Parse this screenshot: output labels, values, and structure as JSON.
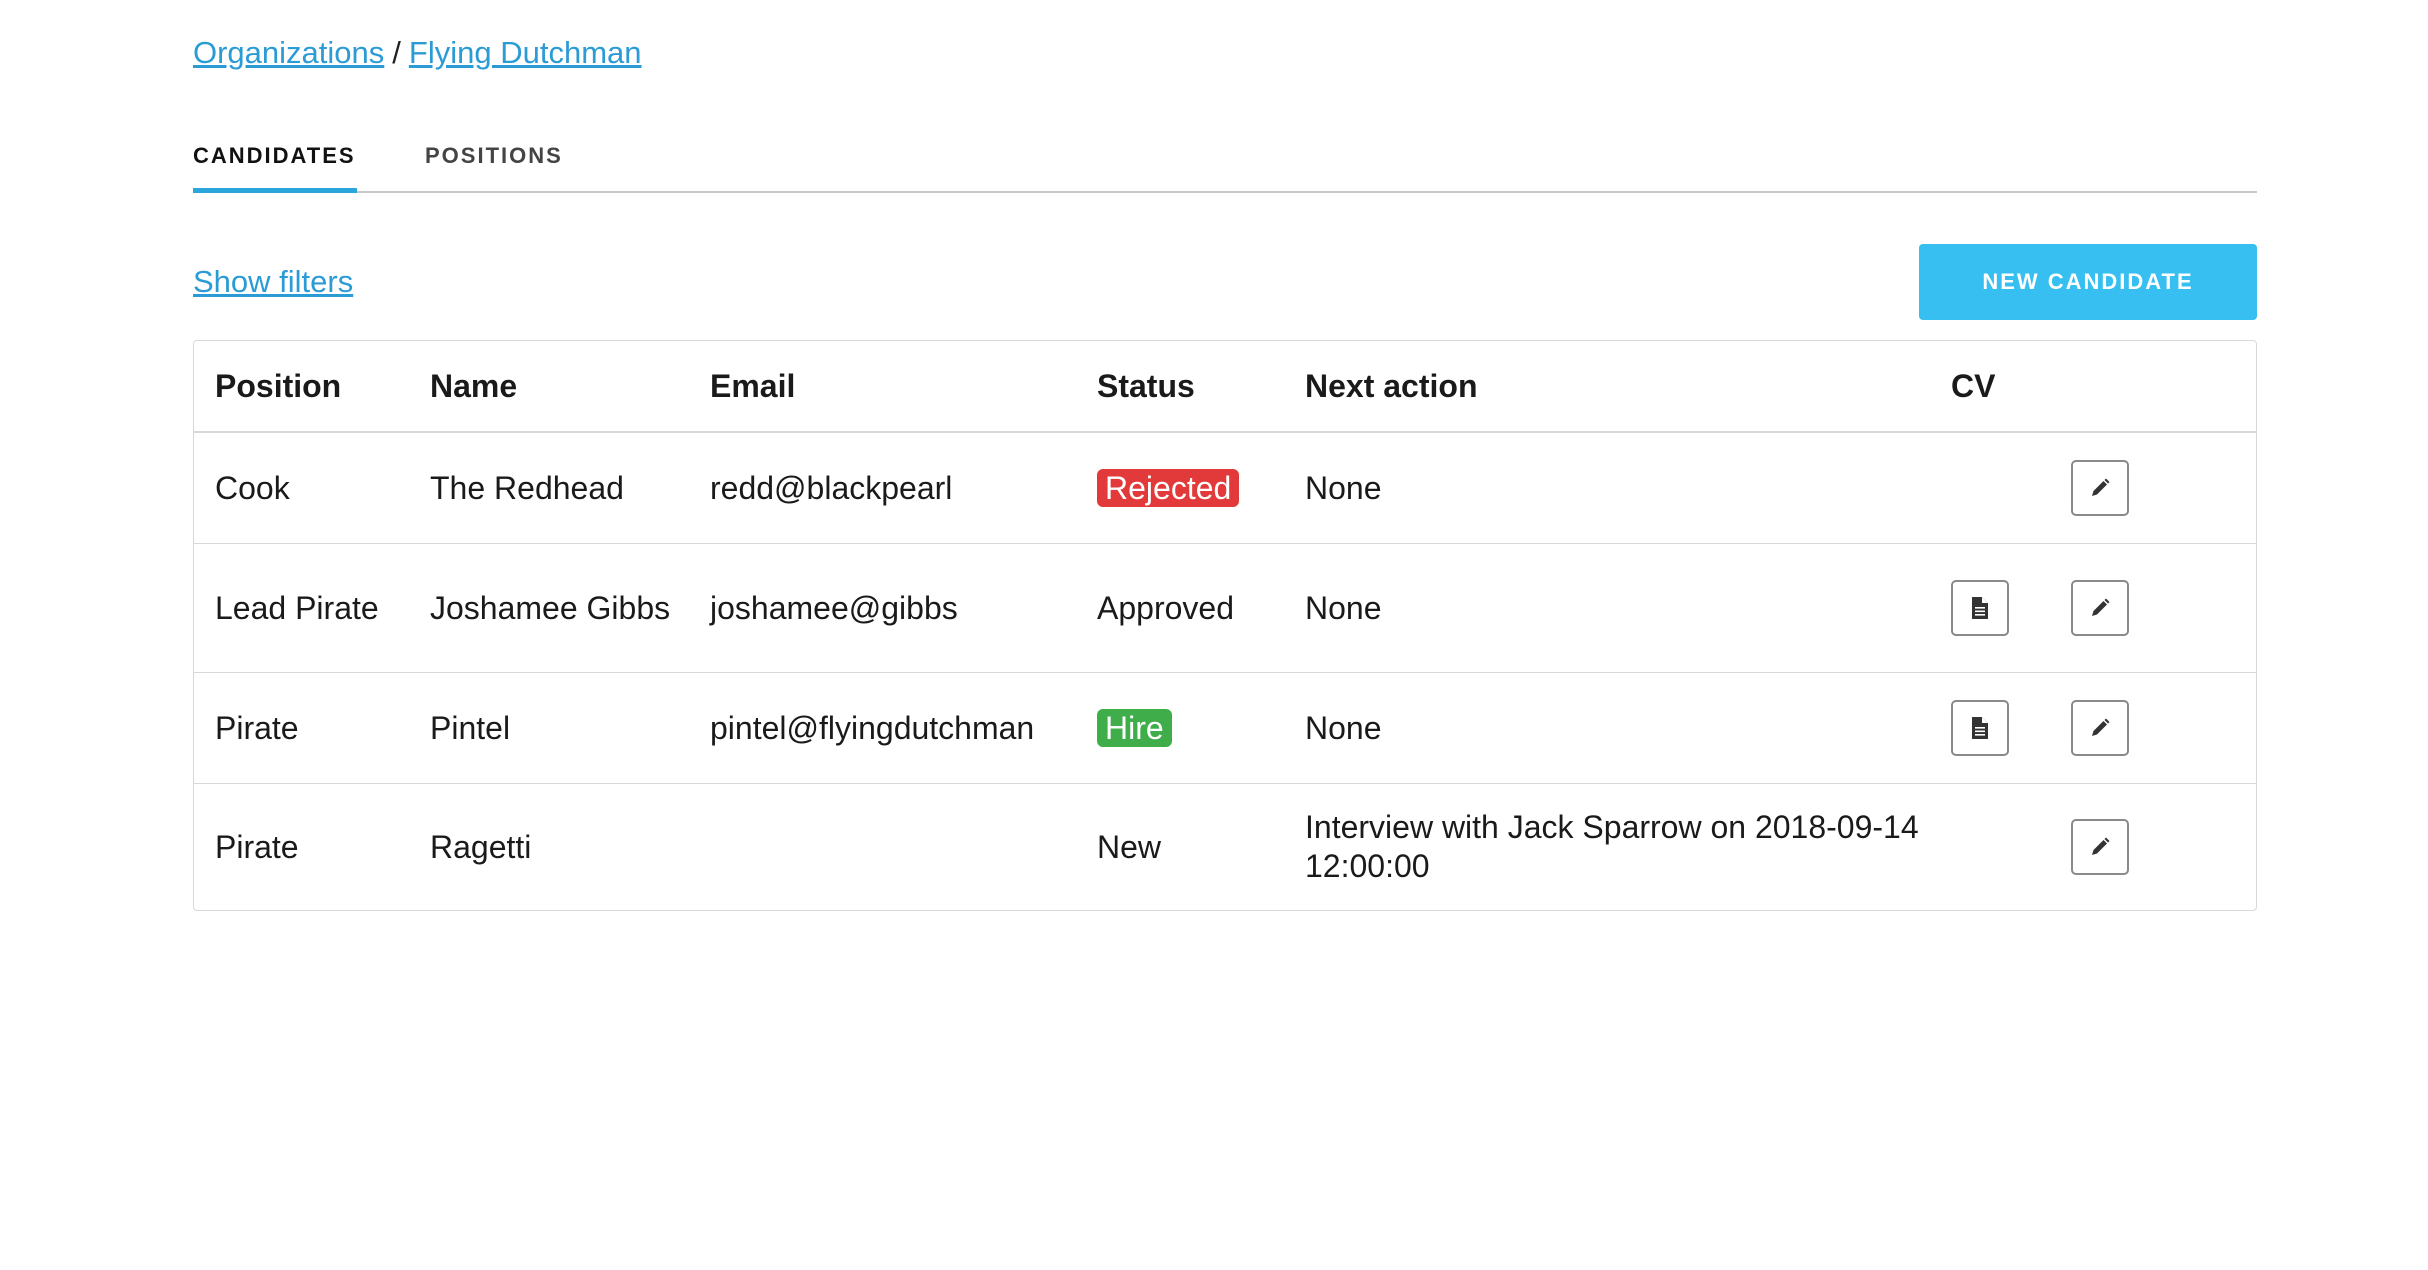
{
  "breadcrumb": {
    "organizations": "Organizations",
    "separator": "/",
    "current": "Flying Dutchman"
  },
  "tabs": [
    {
      "label": "CANDIDATES",
      "active": true
    },
    {
      "label": "POSITIONS",
      "active": false
    }
  ],
  "toolbar": {
    "show_filters": "Show filters",
    "new_candidate": "NEW CANDIDATE"
  },
  "table": {
    "headers": [
      "Position",
      "Name",
      "Email",
      "Status",
      "Next action",
      "CV"
    ],
    "rows": [
      {
        "position": "Cook",
        "name": "The Redhead",
        "email": "redd@blackpearl",
        "status": "Rejected",
        "status_style": "badge-red",
        "next_action": "None",
        "has_cv": false
      },
      {
        "position": "Lead Pirate",
        "name": "Joshamee Gibbs",
        "email": "joshamee@gibbs",
        "status": "Approved",
        "status_style": "plain",
        "next_action": "None",
        "has_cv": true
      },
      {
        "position": "Pirate",
        "name": "Pintel",
        "email": "pintel@flyingdutchman",
        "status": "Hire",
        "status_style": "badge-green",
        "next_action": "None",
        "has_cv": true
      },
      {
        "position": "Pirate",
        "name": "Ragetti",
        "email": "",
        "status": "New",
        "status_style": "plain",
        "next_action": "Interview with Jack Sparrow on 2018-09-14 12:00:00",
        "has_cv": false
      }
    ]
  },
  "colors": {
    "link": "#2b9bd6",
    "accent": "#36bff0",
    "rejected": "#e23a3a",
    "hire": "#3fae4a"
  },
  "icons": {
    "cv": "document-icon",
    "edit": "pencil-icon"
  }
}
